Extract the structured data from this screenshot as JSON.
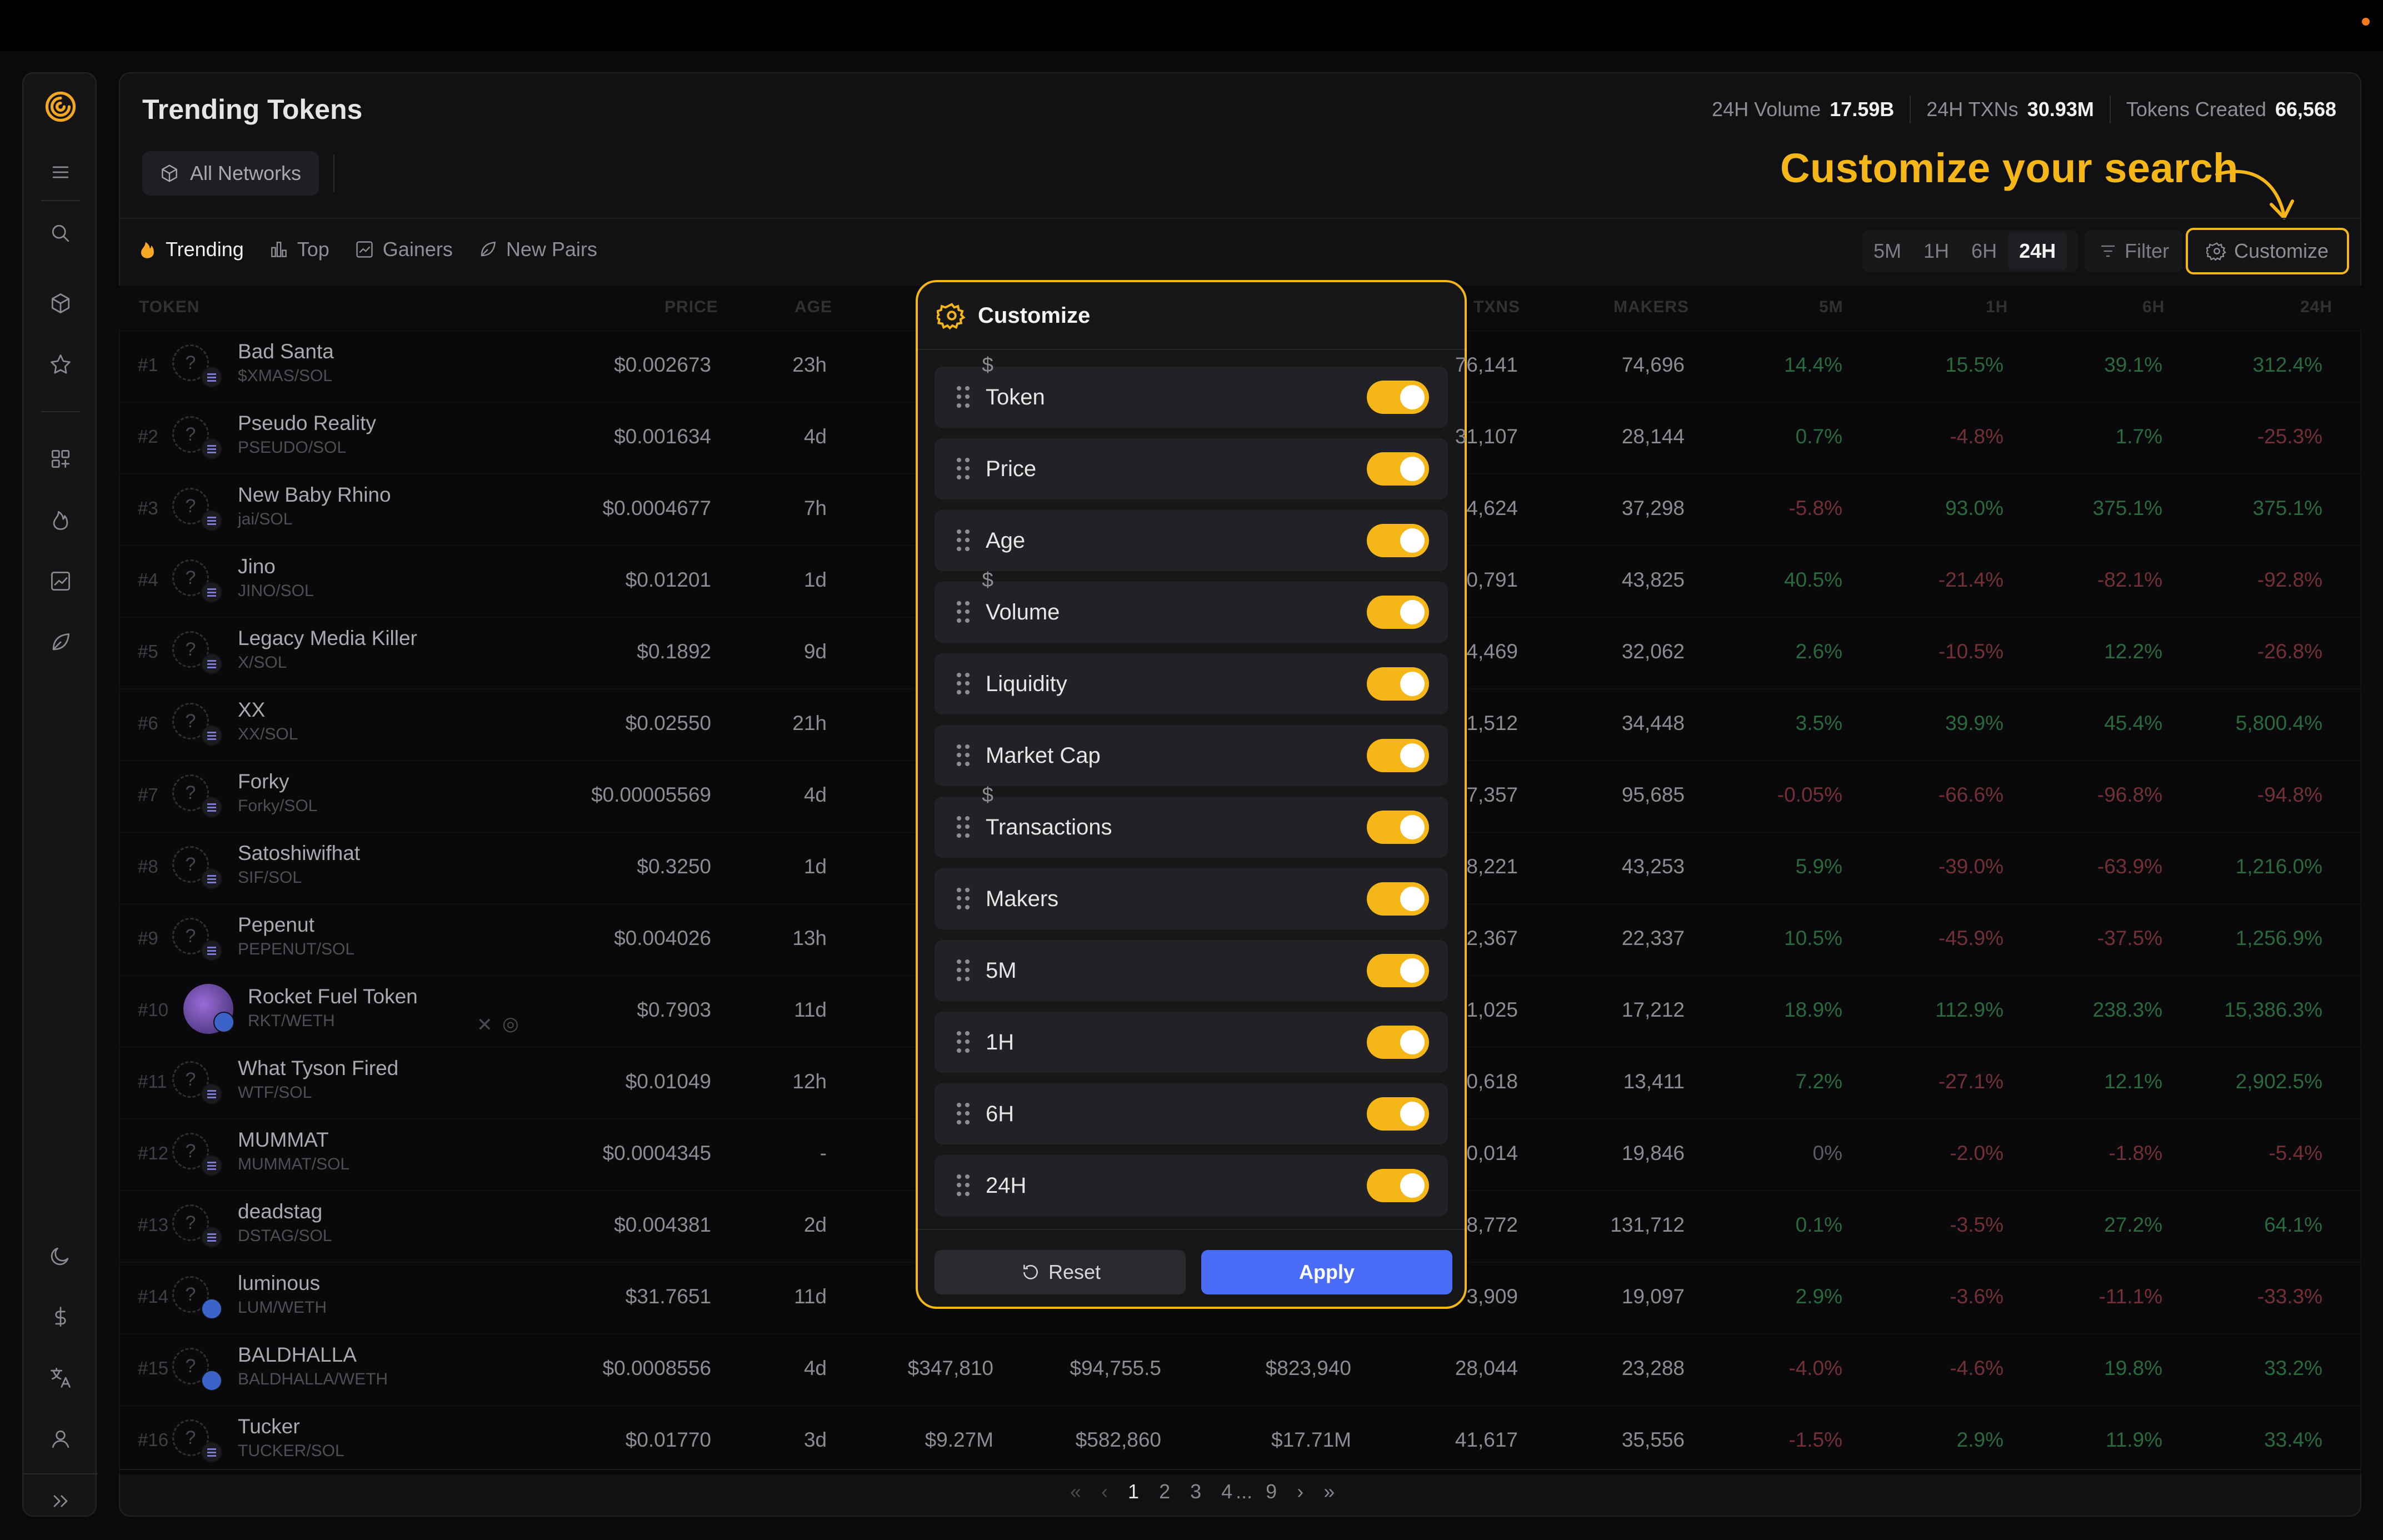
{
  "header": {
    "title": "Trending Tokens",
    "stats": [
      {
        "label": "24H Volume",
        "value": "17.59B"
      },
      {
        "label": "24H TXNs",
        "value": "30.93M"
      },
      {
        "label": "Tokens Created",
        "value": "66,568"
      }
    ],
    "network_button": "All Networks",
    "callout": "Customize your search"
  },
  "tabs": [
    {
      "label": "Trending",
      "icon": "flame-icon",
      "active": true
    },
    {
      "label": "Top",
      "icon": "bar-chart-icon"
    },
    {
      "label": "Gainers",
      "icon": "trend-chart-icon"
    },
    {
      "label": "New Pairs",
      "icon": "leaf-icon"
    }
  ],
  "timeframes": [
    "5M",
    "1H",
    "6H",
    "24H"
  ],
  "timeframe_selected": "24H",
  "filter_label": "Filter",
  "customize_label": "Customize",
  "columns": {
    "token": "TOKEN",
    "price": "PRICE",
    "age": "AGE",
    "txns": "TXNS",
    "makers": "MAKERS",
    "m5": "5M",
    "h1": "1H",
    "h6": "6H",
    "h24": "24H"
  },
  "rows": [
    {
      "rank": "#1",
      "avatar": "?",
      "name": "Bad Santa",
      "pair": "$XMAS/SOL",
      "price": "$0.002673",
      "age": "23h",
      "vol": "$",
      "txns": "76,141",
      "makers": "74,696",
      "m5": "14.4%",
      "h1": "15.5%",
      "h6": "39.1%",
      "h24": "312.4%"
    },
    {
      "rank": "#2",
      "avatar": "?",
      "name": "Pseudo Reality",
      "pair": "PSEUDO/SOL",
      "price": "$0.001634",
      "age": "4d",
      "vol": "",
      "txns": "31,107",
      "makers": "28,144",
      "m5": "0.7%",
      "h1": "-4.8%",
      "h6": "1.7%",
      "h24": "-25.3%"
    },
    {
      "rank": "#3",
      "avatar": "?",
      "name": "New Baby Rhino",
      "pair": "jai/SOL",
      "price": "$0.0004677",
      "age": "7h",
      "vol": "",
      "txns": "4,624",
      "makers": "37,298",
      "m5": "-5.8%",
      "h1": "93.0%",
      "h6": "375.1%",
      "h24": "375.1%"
    },
    {
      "rank": "#4",
      "avatar": "?",
      "name": "Jino",
      "pair": "JINO/SOL",
      "price": "$0.01201",
      "age": "1d",
      "vol": "$",
      "txns": "0,791",
      "makers": "43,825",
      "m5": "40.5%",
      "h1": "-21.4%",
      "h6": "-82.1%",
      "h24": "-92.8%"
    },
    {
      "rank": "#5",
      "avatar": "?",
      "name": "Legacy Media Killer",
      "pair": "X/SOL",
      "price": "$0.1892",
      "age": "9d",
      "vol": "",
      "txns": "4,469",
      "makers": "32,062",
      "m5": "2.6%",
      "h1": "-10.5%",
      "h6": "12.2%",
      "h24": "-26.8%"
    },
    {
      "rank": "#6",
      "avatar": "?",
      "name": "XX",
      "pair": "XX/SOL",
      "price": "$0.02550",
      "age": "21h",
      "vol": "",
      "txns": "1,512",
      "makers": "34,448",
      "m5": "3.5%",
      "h1": "39.9%",
      "h6": "45.4%",
      "h24": "5,800.4%"
    },
    {
      "rank": "#7",
      "avatar": "?",
      "name": "Forky",
      "pair": "Forky/SOL",
      "price": "$0.00005569",
      "age": "4d",
      "vol": "$",
      "txns": "7,357",
      "makers": "95,685",
      "m5": "-0.05%",
      "h1": "-66.6%",
      "h6": "-96.8%",
      "h24": "-94.8%"
    },
    {
      "rank": "#8",
      "avatar": "?",
      "name": "Satoshiwifhat",
      "pair": "SIF/SOL",
      "price": "$0.3250",
      "age": "1d",
      "vol": "",
      "txns": "8,221",
      "makers": "43,253",
      "m5": "5.9%",
      "h1": "-39.0%",
      "h6": "-63.9%",
      "h24": "1,216.0%"
    },
    {
      "rank": "#9",
      "avatar": "?",
      "name": "Pepenut",
      "pair": "PEPENUT/SOL",
      "price": "$0.004026",
      "age": "13h",
      "vol": "",
      "txns": "2,367",
      "makers": "22,337",
      "m5": "10.5%",
      "h1": "-45.9%",
      "h6": "-37.5%",
      "h24": "1,256.9%"
    },
    {
      "rank": "#10",
      "avatar": "",
      "name": "Rocket Fuel Token",
      "pair": "RKT/WETH",
      "price": "$0.7903",
      "age": "11d",
      "vol": "",
      "txns": "1,025",
      "makers": "17,212",
      "m5": "18.9%",
      "h1": "112.9%",
      "h6": "238.3%",
      "h24": "15,386.3%"
    },
    {
      "rank": "#11",
      "avatar": "?",
      "name": "What Tyson Fired",
      "pair": "WTF/SOL",
      "price": "$0.01049",
      "age": "12h",
      "vol": "",
      "txns": "0,618",
      "makers": "13,411",
      "m5": "7.2%",
      "h1": "-27.1%",
      "h6": "12.1%",
      "h24": "2,902.5%"
    },
    {
      "rank": "#12",
      "avatar": "?",
      "name": "MUMMAT",
      "pair": "MUMMAT/SOL",
      "price": "$0.0004345",
      "age": "-",
      "vol": "",
      "txns": "0,014",
      "makers": "19,846",
      "m5": "0%",
      "h1": "-2.0%",
      "h6": "-1.8%",
      "h24": "-5.4%"
    },
    {
      "rank": "#13",
      "avatar": "?",
      "name": "deadstag",
      "pair": "DSTAG/SOL",
      "price": "$0.004381",
      "age": "2d",
      "vol": "",
      "txns": "8,772",
      "makers": "131,712",
      "m5": "0.1%",
      "h1": "-3.5%",
      "h6": "27.2%",
      "h24": "64.1%"
    },
    {
      "rank": "#14",
      "avatar": "?",
      "name": "luminous",
      "pair": "LUM/WETH",
      "price": "$31.7651",
      "age": "11d",
      "vol": "",
      "txns": "3,909",
      "makers": "19,097",
      "m5": "2.9%",
      "h1": "-3.6%",
      "h6": "-11.1%",
      "h24": "-33.3%"
    },
    {
      "rank": "#15",
      "avatar": "?",
      "name": "BALDHALLA",
      "pair": "BALDHALLA/WETH",
      "price": "$0.0008556",
      "age": "4d",
      "vol": "$347,810",
      "liq": "$94,755.5",
      "mcap": "$823,940",
      "txns": "28,044",
      "makers": "23,288",
      "m5": "-4.0%",
      "h1": "-4.6%",
      "h6": "19.8%",
      "h24": "33.2%"
    },
    {
      "rank": "#16",
      "avatar": "?",
      "name": "Tucker",
      "pair": "TUCKER/SOL",
      "price": "$0.01770",
      "age": "3d",
      "vol": "$9.27M",
      "liq": "$582,860",
      "mcap": "$17.71M",
      "txns": "41,617",
      "makers": "35,556",
      "m5": "-1.5%",
      "h1": "2.9%",
      "h6": "11.9%",
      "h24": "33.4%"
    }
  ],
  "pagination": {
    "first": "«",
    "prev": "‹",
    "pages": [
      "1",
      "2",
      "3",
      "4"
    ],
    "ellipsis": "...",
    "last_page": "9",
    "next": "›",
    "last": "»",
    "current": "1"
  },
  "modal": {
    "title": "Customize",
    "options": [
      "Token",
      "Price",
      "Age",
      "Volume",
      "Liquidity",
      "Market Cap",
      "Transactions",
      "Makers",
      "5M",
      "1H",
      "6H",
      "24H"
    ],
    "reset_label": "Reset",
    "apply_label": "Apply"
  },
  "colors": {
    "accent": "#f5b718",
    "apply": "#4a6cf7",
    "positive": "#2a6a3d",
    "negative": "#733036"
  },
  "sidebar_icons": [
    "logo-icon",
    "menu-icon",
    "search-icon",
    "cube-icon",
    "star-icon",
    "grid-plus-icon",
    "flame-icon",
    "chart-icon",
    "leaf-icon",
    "moon-icon",
    "dollar-icon",
    "translate-icon",
    "user-icon",
    "expand-icon"
  ]
}
